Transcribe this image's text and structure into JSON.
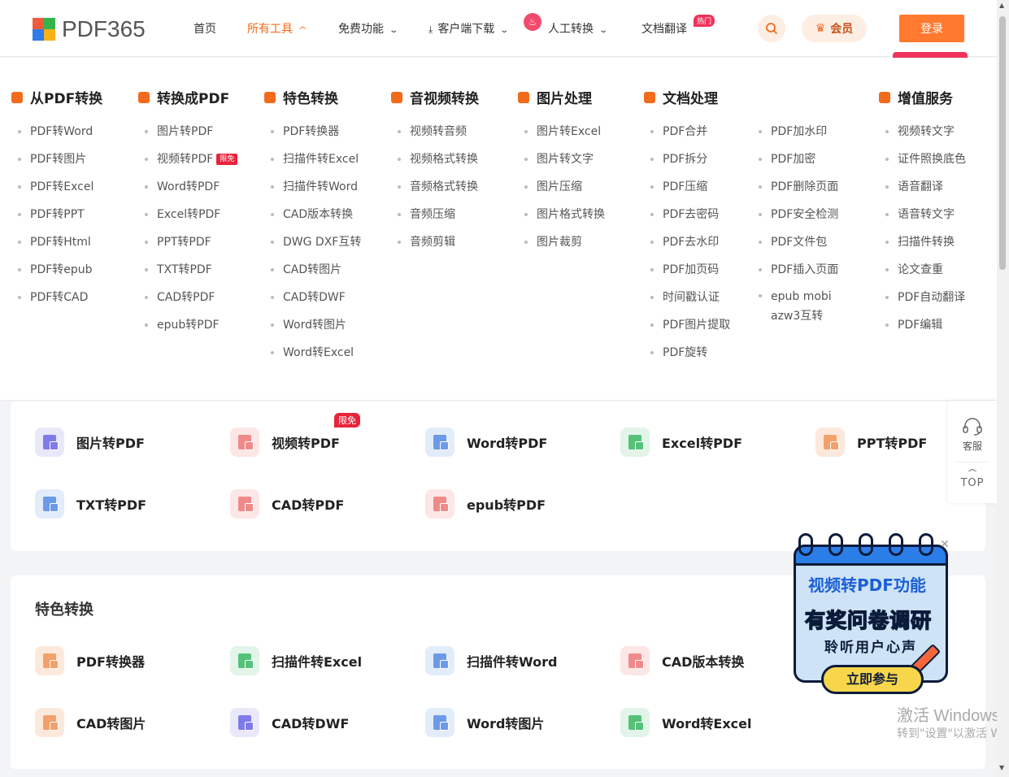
{
  "brand": {
    "name": "PDF365"
  },
  "nav": {
    "home": "首页",
    "all_tools": "所有工具",
    "free": "免费功能",
    "download": "客户端下载",
    "manual": "人工转换",
    "translate": "文档翻译",
    "hot_badge": "热门",
    "vip": "会员",
    "login": "登录"
  },
  "categories": [
    {
      "title": "从PDF转换",
      "icon": "pdf-export-icon",
      "color": "#f26b1d",
      "items": [
        "PDF转Word",
        "PDF转图片",
        "PDF转Excel",
        "PDF转PPT",
        "PDF转Html",
        "PDF转epub",
        "PDF转CAD"
      ]
    },
    {
      "title": "转换成PDF",
      "icon": "pdf-import-icon",
      "color": "#f26b1d",
      "items": [
        "图片转PDF",
        "视频转PDF",
        "Word转PDF",
        "Excel转PDF",
        "PPT转PDF",
        "TXT转PDF",
        "CAD转PDF",
        "epub转PDF"
      ]
    },
    {
      "title": "特色转换",
      "icon": "shield-star-icon",
      "color": "#f26b1d",
      "items": [
        "PDF转换器",
        "扫描件转Excel",
        "扫描件转Word",
        "CAD版本转换",
        "DWG DXF互转",
        "CAD转图片",
        "CAD转DWF",
        "Word转图片",
        "Word转Excel"
      ]
    },
    {
      "title": "音视频转换",
      "icon": "play-icon",
      "color": "#f26b1d",
      "items": [
        "视频转音频",
        "视频格式转换",
        "音频格式转换",
        "音频压缩",
        "音频剪辑"
      ]
    },
    {
      "title": "图片处理",
      "icon": "image-icon",
      "color": "#f26b1d",
      "items": [
        "图片转Excel",
        "图片转文字",
        "图片压缩",
        "图片格式转换",
        "图片裁剪"
      ]
    },
    {
      "title": "文档处理",
      "icon": "document-icon",
      "color": "#f26b1d",
      "items": [
        "PDF合并",
        "PDF拆分",
        "PDF压缩",
        "PDF去密码",
        "PDF去水印",
        "PDF加页码",
        "时间戳认证",
        "PDF图片提取",
        "PDF旋转"
      ],
      "items2": [
        "PDF加水印",
        "PDF加密",
        "PDF删除页面",
        "PDF安全检测",
        "PDF文件包",
        "PDF插入页面",
        "epub mobi azw3互转"
      ]
    },
    {
      "title": "增值服务",
      "icon": "list-icon",
      "color": "#f26b1d",
      "items": [
        "视频转文字",
        "证件照换底色",
        "语音翻译",
        "语音转文字",
        "扫描件转换",
        "论文查重",
        "PDF自动翻译",
        "PDF编辑"
      ]
    }
  ],
  "limited_free": "限免",
  "to_pdf_tools": [
    {
      "label": "图片转PDF",
      "bg": "#e9e8fb",
      "fg": "#7f7bea"
    },
    {
      "label": "视频转PDF",
      "bg": "#fde6e6",
      "fg": "#f08a8a"
    },
    {
      "label": "Word转PDF",
      "bg": "#e3ecfb",
      "fg": "#6d9ae8"
    },
    {
      "label": "Excel转PDF",
      "bg": "#e2f5e8",
      "fg": "#55c27a"
    },
    {
      "label": "PPT转PDF",
      "bg": "#fde9dc",
      "fg": "#f3a06b"
    },
    {
      "label": "TXT转PDF",
      "bg": "#e3ecfb",
      "fg": "#6d9ae8"
    },
    {
      "label": "CAD转PDF",
      "bg": "#fde6e6",
      "fg": "#f08a8a"
    },
    {
      "label": "epub转PDF",
      "bg": "#fde6e6",
      "fg": "#f08a8a"
    }
  ],
  "featured": {
    "title": "特色转换",
    "tools": [
      {
        "label": "PDF转换器",
        "bg": "#fde9dc",
        "fg": "#f3a06b"
      },
      {
        "label": "扫描件转Excel",
        "bg": "#e2f5e8",
        "fg": "#55c27a"
      },
      {
        "label": "扫描件转Word",
        "bg": "#e3ecfb",
        "fg": "#6d9ae8"
      },
      {
        "label": "CAD版本转换",
        "bg": "#fde6e6",
        "fg": "#f08a8a"
      },
      {
        "label": "CAD转图片",
        "bg": "#fde9dc",
        "fg": "#f3a06b"
      },
      {
        "label": "CAD转DWF",
        "bg": "#e9e8fb",
        "fg": "#7f7bea"
      },
      {
        "label": "Word转图片",
        "bg": "#e3ecfb",
        "fg": "#6d9ae8"
      },
      {
        "label": "Word转Excel",
        "bg": "#e2f5e8",
        "fg": "#55c27a"
      }
    ]
  },
  "float": {
    "service": "客服",
    "top": "TOP"
  },
  "survey": {
    "line1": "视频转PDF功能",
    "line2": "有奖问卷调研",
    "line3": "聆听用户心声",
    "button": "立即参与"
  },
  "watermark": {
    "line1": "激活 Windows",
    "line2": "转到\"设置\"以激活 Wi"
  }
}
